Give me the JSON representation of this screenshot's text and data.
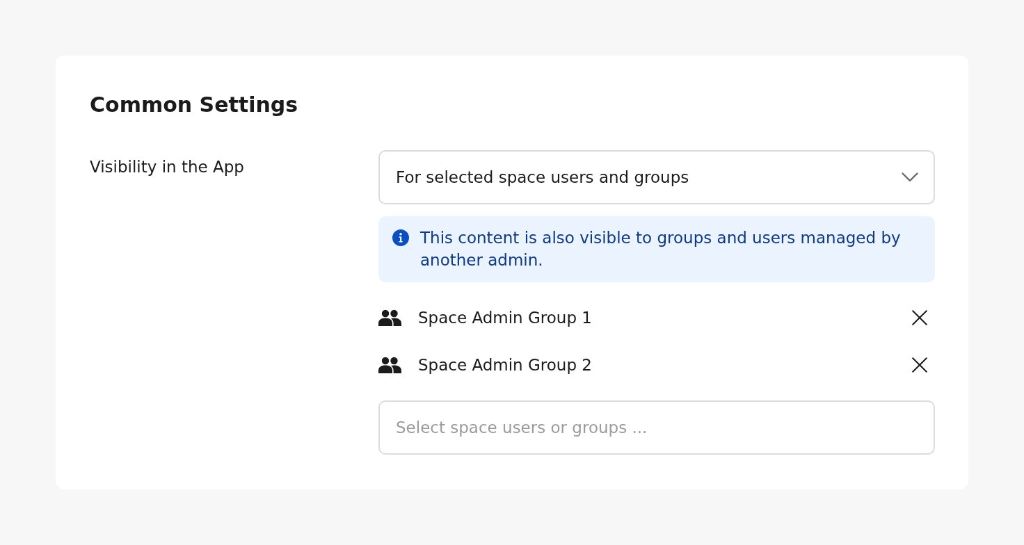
{
  "title": "Common Settings",
  "visibility": {
    "label": "Visibility in the App",
    "select": {
      "value": "For selected space users and groups"
    },
    "notice": {
      "text": "This content is also visible to groups and users managed by another admin."
    },
    "groups": [
      {
        "name": "Space Admin Group 1"
      },
      {
        "name": "Space Admin Group 2"
      }
    ],
    "picker": {
      "placeholder": "Select space users or groups ..."
    }
  }
}
